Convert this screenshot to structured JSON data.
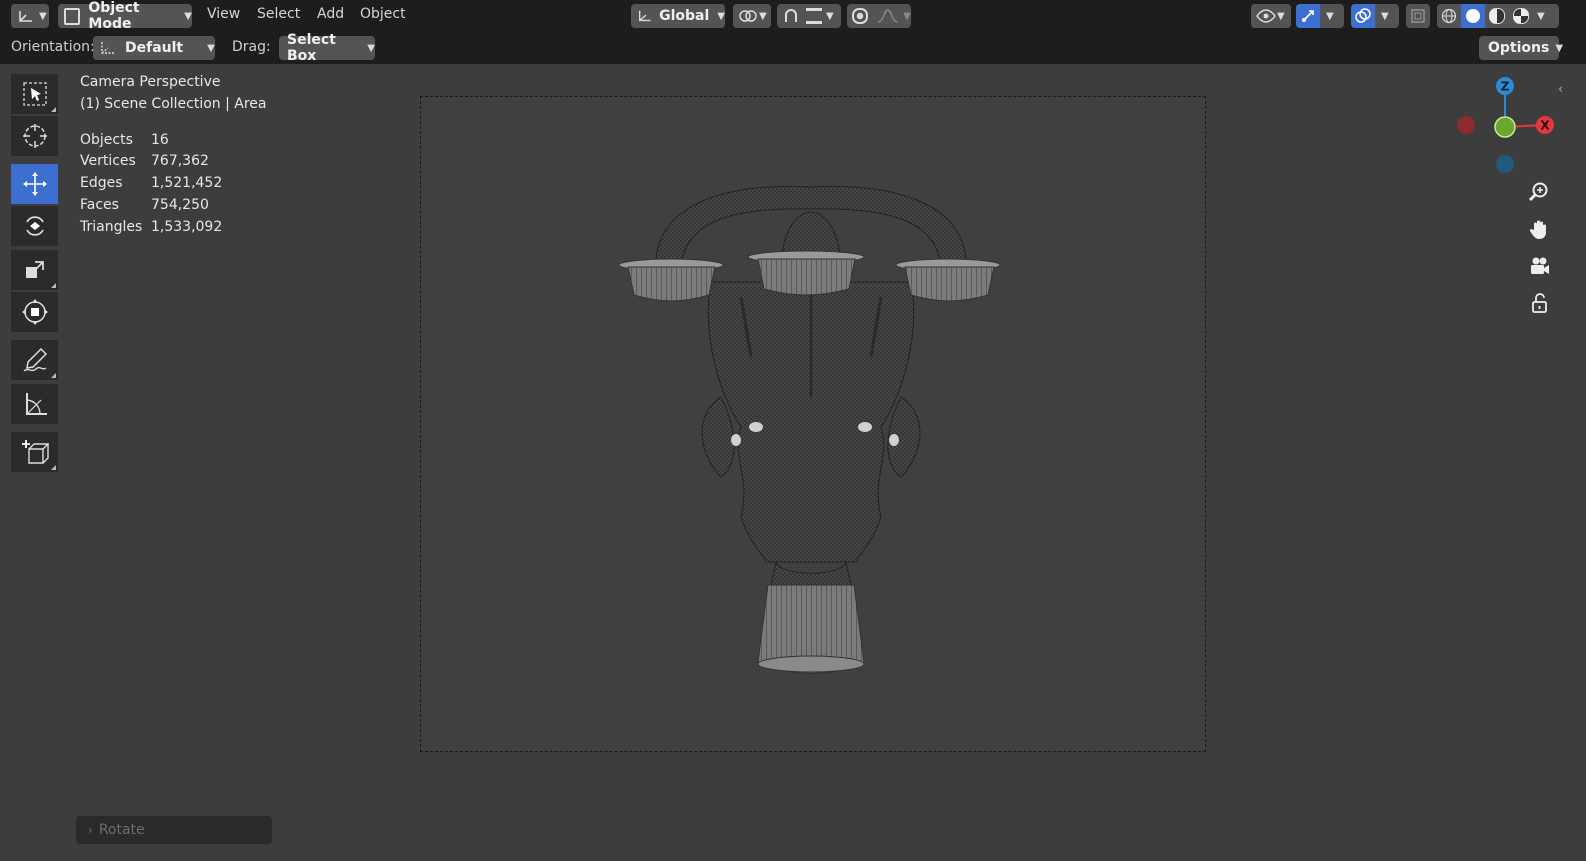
{
  "header": {
    "mode_label": "Object Mode",
    "menus": [
      "View",
      "Select",
      "Add",
      "Object"
    ],
    "transform_orientation": "Global",
    "options_label": "Options"
  },
  "toolbar": {
    "orientation_label": "Orientation:",
    "orientation_value": "Default",
    "drag_label": "Drag:",
    "drag_value": "Select Box"
  },
  "tools": [
    {
      "name": "select-box-tool-icon",
      "active": false
    },
    {
      "name": "cursor-tool-icon",
      "active": false
    },
    {
      "name": "move-tool-icon",
      "active": true
    },
    {
      "name": "rotate-tool-icon",
      "active": false
    },
    {
      "name": "scale-tool-icon",
      "active": false
    },
    {
      "name": "transform-tool-icon",
      "active": false
    },
    {
      "name": "annotate-tool-icon",
      "active": false
    },
    {
      "name": "measure-tool-icon",
      "active": false
    },
    {
      "name": "add-cube-tool-icon",
      "active": false
    }
  ],
  "overlay": {
    "view_name": "Camera Perspective",
    "collection": "(1) Scene Collection | Area",
    "stats": [
      {
        "label": "Objects",
        "value": "16"
      },
      {
        "label": "Vertices",
        "value": "767,362"
      },
      {
        "label": "Edges",
        "value": "1,521,452"
      },
      {
        "label": "Faces",
        "value": "754,250"
      },
      {
        "label": "Triangles",
        "value": "1,533,092"
      }
    ]
  },
  "gizmo": {
    "z_label": "Z",
    "x_label": "X",
    "colors": {
      "x": "#e0383e",
      "y": "#6aa82c",
      "z": "#2e8ad1"
    }
  },
  "last_operator": "Rotate",
  "colors": {
    "accent": "#3d6fd0",
    "header_bg": "#1d1d1d",
    "viewport_bg": "#3d3d3d"
  }
}
